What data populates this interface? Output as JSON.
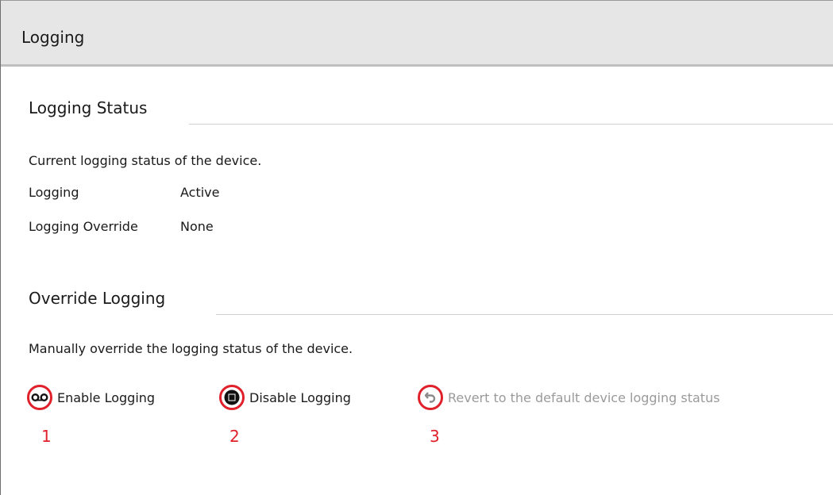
{
  "window": {
    "title": "Logging"
  },
  "status_section": {
    "heading": "Logging Status",
    "description": "Current logging status of the device.",
    "rows": [
      {
        "label": "Logging",
        "value": "Active"
      },
      {
        "label": "Logging Override",
        "value": "None"
      }
    ]
  },
  "override_section": {
    "heading": "Override Logging",
    "description": "Manually override the logging status of the device.",
    "actions": [
      {
        "label": "Enable Logging",
        "icon": "voicemail-icon",
        "enabled": true
      },
      {
        "label": "Disable Logging",
        "icon": "stop-icon",
        "enabled": true
      },
      {
        "label": "Revert to the default device logging status",
        "icon": "undo-icon",
        "enabled": false
      }
    ]
  },
  "callouts": [
    "1",
    "2",
    "3"
  ],
  "colors": {
    "callout": "#e0202a",
    "titlebar": "#e6e6e6",
    "disabled_text": "#9a9a9a"
  }
}
